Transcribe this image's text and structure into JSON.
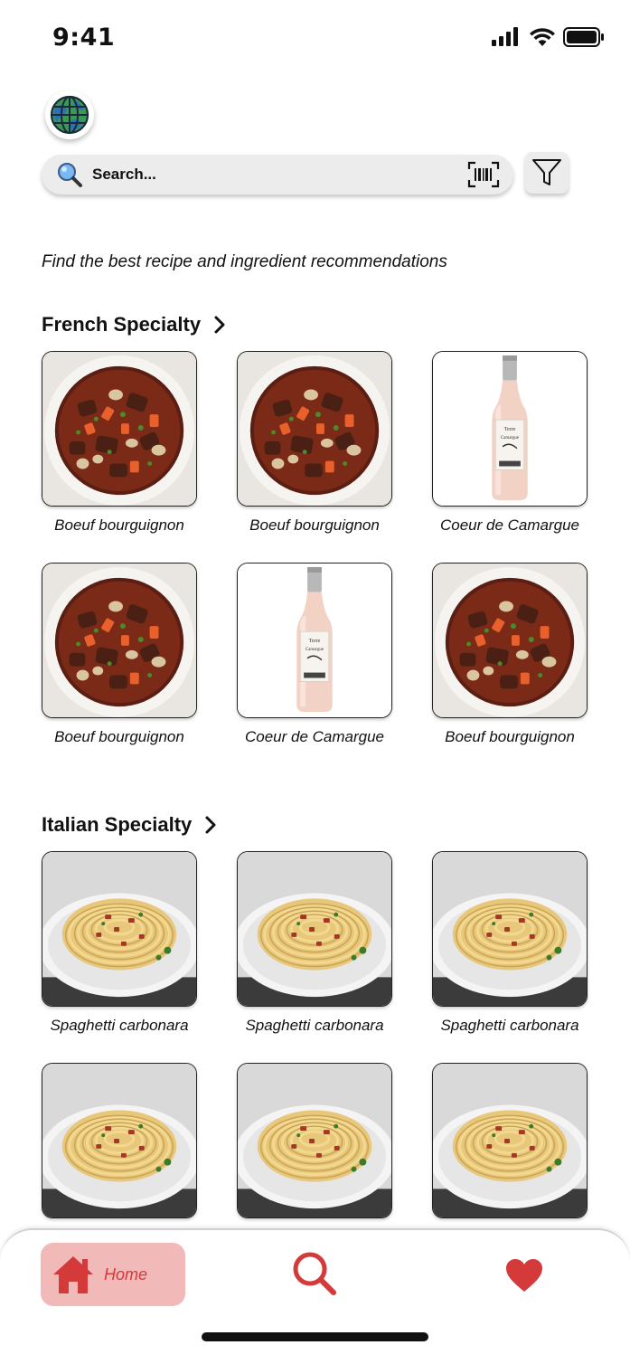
{
  "status_bar": {
    "time": "9:41"
  },
  "search": {
    "placeholder": "Search..."
  },
  "tagline": "Find the best recipe and ingredient recommendations",
  "sections": [
    {
      "title": "French Specialty",
      "items": [
        {
          "label": "Boeuf bourguignon",
          "image": "beef-stew"
        },
        {
          "label": "Boeuf bourguignon",
          "image": "beef-stew"
        },
        {
          "label": "Coeur de Camargue",
          "image": "rose-wine-bottle"
        },
        {
          "label": "Boeuf bourguignon",
          "image": "beef-stew"
        },
        {
          "label": "Coeur de Camargue",
          "image": "rose-wine-bottle"
        },
        {
          "label": "Boeuf bourguignon",
          "image": "beef-stew"
        }
      ]
    },
    {
      "title": "Italian Specialty",
      "items": [
        {
          "label": "Spaghetti carbonara",
          "image": "spaghetti-carbonara"
        },
        {
          "label": "Spaghetti carbonara",
          "image": "spaghetti-carbonara"
        },
        {
          "label": "Spaghetti carbonara",
          "image": "spaghetti-carbonara"
        },
        {
          "label": "",
          "image": "spaghetti-carbonara"
        },
        {
          "label": "",
          "image": "spaghetti-carbonara"
        },
        {
          "label": "",
          "image": "spaghetti-carbonara"
        }
      ]
    }
  ],
  "bottom_nav": {
    "home_label": "Home",
    "active": "home",
    "accent_color": "#d43a3a",
    "active_bg": "#f2b9b9"
  },
  "icons": {
    "globe": "globe-icon",
    "search": "search-icon",
    "barcode": "barcode-scan-icon",
    "filter": "filter-icon",
    "home": "home-icon",
    "favorites": "heart-icon"
  }
}
